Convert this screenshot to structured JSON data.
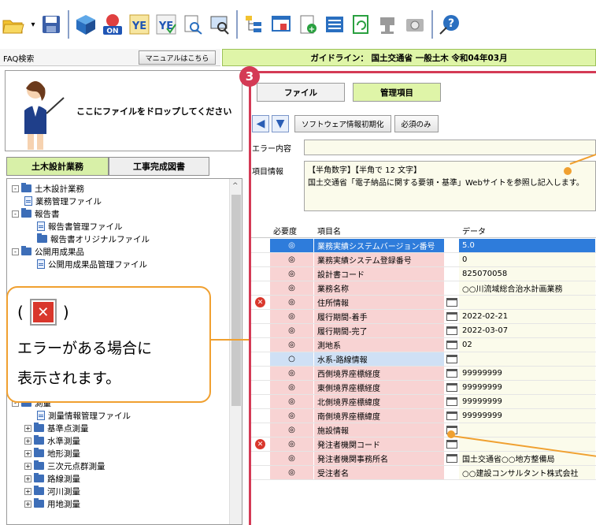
{
  "toolbar": {
    "icons": [
      "open-folder-icon",
      "save-icon",
      "cube-icon",
      "on-icon",
      "ye-icon",
      "ye-check-icon",
      "search-doc-icon",
      "monitor-search-icon",
      "tree-icon",
      "window-add-icon",
      "doc-add-icon",
      "list-icon",
      "refresh-doc-icon",
      "stamp-icon",
      "camera-icon",
      "help-icon"
    ]
  },
  "left": {
    "faq_label": "FAQ検索",
    "manual_button": "マニュアルはこちら",
    "drop_text": "ここにファイルをドロップしてください",
    "tab_civil": "土木設計業務",
    "tab_completion": "工事完成図書"
  },
  "tree": [
    {
      "label": "土木設計業務",
      "type": "folder",
      "exp": "-",
      "level": 0
    },
    {
      "label": "業務管理ファイル",
      "type": "file",
      "level": 1
    },
    {
      "label": "報告書",
      "type": "folder",
      "exp": "-",
      "level": 0
    },
    {
      "label": "報告書管理ファイル",
      "type": "file",
      "level": 2
    },
    {
      "label": "報告書オリジナルファイル",
      "type": "folder",
      "level": 2
    },
    {
      "label": "公開用成果品",
      "type": "folder",
      "exp": "-",
      "level": 0
    },
    {
      "label": "公開用成果品管理ファイル",
      "type": "file",
      "level": 2
    },
    {
      "label": "測量",
      "type": "folder",
      "exp": "-",
      "level": 0,
      "row": 17
    },
    {
      "label": "測量情報管理ファイル",
      "type": "file",
      "level": 2,
      "row": 18
    },
    {
      "label": "基準点測量",
      "type": "folder",
      "exp": "+",
      "level": 1,
      "row": 19
    },
    {
      "label": "水準測量",
      "type": "folder",
      "exp": "+",
      "level": 1,
      "row": 20
    },
    {
      "label": "地形測量",
      "type": "folder",
      "exp": "+",
      "level": 1,
      "row": 21
    },
    {
      "label": "三次元点群測量",
      "type": "folder",
      "exp": "+",
      "level": 1,
      "row": 22
    },
    {
      "label": "路線測量",
      "type": "folder",
      "exp": "+",
      "level": 1,
      "row": 23
    },
    {
      "label": "河川測量",
      "type": "folder",
      "exp": "+",
      "level": 1,
      "row": 24
    },
    {
      "label": "用地測量",
      "type": "folder",
      "exp": "+",
      "level": 1,
      "row": 25
    }
  ],
  "callout": {
    "paren_open": "(",
    "paren_close": ")",
    "line2": "エラーがある場合に",
    "line3": "表示されます。"
  },
  "right": {
    "guideline": "ガイドライン： 国土交通省 一般土木 令和04年03月",
    "badge": "3",
    "tab_file": "ファイル",
    "tab_items": "管理項目",
    "btn_init": "ソフトウェア情報初期化",
    "btn_required": "必須のみ",
    "err_label": "エラー内容",
    "info_label": "項目情報",
    "info_line1": "【半角数字】【半角で 12 文字】",
    "info_line2": "国土交通省「電子納品に関する要領・基準」Webサイトを参照し記入します。"
  },
  "grid": {
    "headers": {
      "req": "必要度",
      "name": "項目名",
      "data": "データ"
    },
    "rows": [
      {
        "err": false,
        "req": "◎",
        "name": "業務実績システムバージョン番号",
        "edit": false,
        "data": "5.0",
        "style": "sel"
      },
      {
        "err": false,
        "req": "◎",
        "name": "業務実績システム登録番号",
        "edit": false,
        "data": "0",
        "style": "pink"
      },
      {
        "err": false,
        "req": "◎",
        "name": "設計書コード",
        "edit": false,
        "data": "825070058",
        "style": "pink"
      },
      {
        "err": false,
        "req": "◎",
        "name": "業務名称",
        "edit": false,
        "data": "○○川流域総合治水計画業務",
        "style": "pink"
      },
      {
        "err": true,
        "req": "◎",
        "name": "住所情報",
        "edit": true,
        "data": "",
        "style": "pink"
      },
      {
        "err": false,
        "req": "◎",
        "name": "履行期間-着手",
        "edit": true,
        "data": "2022-02-21",
        "style": "pink"
      },
      {
        "err": false,
        "req": "◎",
        "name": "履行期間-完了",
        "edit": true,
        "data": "2022-03-07",
        "style": "pink"
      },
      {
        "err": false,
        "req": "◎",
        "name": "測地系",
        "edit": true,
        "data": "02",
        "style": "pink"
      },
      {
        "err": false,
        "req": "○",
        "name": "水系-路線情報",
        "edit": true,
        "data": "",
        "style": "blue"
      },
      {
        "err": false,
        "req": "◎",
        "name": "西側境界座標経度",
        "edit": true,
        "data": "99999999",
        "style": "pink"
      },
      {
        "err": false,
        "req": "◎",
        "name": "東側境界座標経度",
        "edit": true,
        "data": "99999999",
        "style": "pink"
      },
      {
        "err": false,
        "req": "◎",
        "name": "北側境界座標緯度",
        "edit": true,
        "data": "99999999",
        "style": "pink"
      },
      {
        "err": false,
        "req": "◎",
        "name": "南側境界座標緯度",
        "edit": true,
        "data": "99999999",
        "style": "pink"
      },
      {
        "err": false,
        "req": "◎",
        "name": "施設情報",
        "edit": true,
        "data": "",
        "style": "pink"
      },
      {
        "err": true,
        "req": "◎",
        "name": "発注者機関コード",
        "edit": true,
        "data": "",
        "style": "pink"
      },
      {
        "err": false,
        "req": "◎",
        "name": "発注者機関事務所名",
        "edit": true,
        "data": "国土交通省○○地方整備局",
        "style": "pink"
      },
      {
        "err": false,
        "req": "◎",
        "name": "受注者名",
        "edit": false,
        "data": "○○建設コンサルタント株式会社",
        "style": "pink"
      }
    ]
  },
  "colors": {
    "accent_red": "#d43a55",
    "callout_orange": "#f0a030",
    "guide_green": "#dff5a8",
    "selected_blue": "#2e7cdb"
  }
}
